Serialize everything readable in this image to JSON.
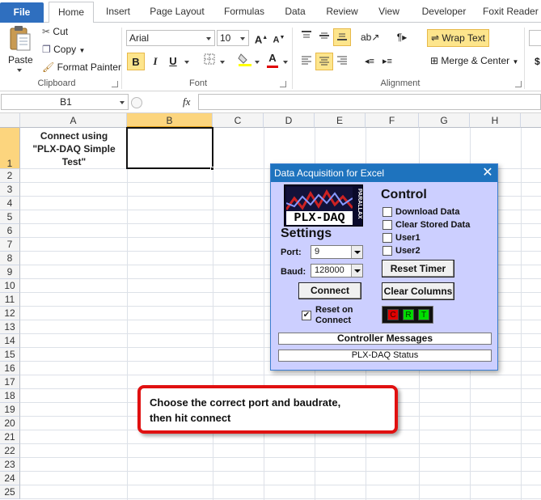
{
  "tabs": [
    "File",
    "Home",
    "Insert",
    "Page Layout",
    "Formulas",
    "Data",
    "Review",
    "View",
    "Developer",
    "Foxit Reader"
  ],
  "ribbon": {
    "clipboard": {
      "paste": "Paste",
      "cut": "Cut",
      "copy": "Copy",
      "format_painter": "Format Painter",
      "label": "Clipboard"
    },
    "font": {
      "name": "Arial",
      "size": "10",
      "bold": "B",
      "italic": "I",
      "underline": "U",
      "label": "Font"
    },
    "alignment": {
      "wrap_text": "Wrap Text",
      "merge_center": "Merge & Center",
      "label": "Alignment"
    },
    "number_symbol": "$"
  },
  "formula_bar": {
    "name_box": "B1",
    "fx": "fx",
    "content": ""
  },
  "grid": {
    "columns": [
      "A",
      "B",
      "C",
      "D",
      "E",
      "F",
      "G",
      "H"
    ],
    "rows": [
      "1",
      "2",
      "3",
      "4",
      "5",
      "6",
      "7",
      "8",
      "9",
      "10",
      "11",
      "12",
      "13",
      "14",
      "15",
      "16",
      "17",
      "18",
      "19",
      "20",
      "21",
      "22",
      "23",
      "24",
      "25"
    ],
    "a1_lines": [
      "Connect using",
      "\"PLX-DAQ Simple",
      "Test\""
    ]
  },
  "dialog": {
    "title": "Data Acquisition for Excel",
    "logo_text": "PLX-DAQ",
    "logo_side": "PARALLAX",
    "settings_heading": "Settings",
    "port_label": "Port:",
    "port_value": "9",
    "baud_label": "Baud:",
    "baud_value": "128000",
    "connect_button": "Connect",
    "reset_on_connect_line1": "Reset on",
    "reset_on_connect_line2": "Connect",
    "control_heading": "Control",
    "download_data": "Download Data",
    "clear_stored_data": "Clear Stored Data",
    "user1": "User1",
    "user2": "User2",
    "reset_timer": "Reset Timer",
    "clear_columns": "Clear Columns",
    "indicators": [
      "C",
      "R",
      "T"
    ],
    "controller_messages": "Controller Messages",
    "status": "PLX-DAQ Status"
  },
  "callout": {
    "line1": "Choose the correct port and baudrate,",
    "line2": "then hit connect"
  },
  "colors": {
    "file_tab": "#2f6fbf",
    "dialog_bg": "#cccfff",
    "dialog_title": "#1e73be",
    "callout_border": "#e01010",
    "indicator_red": "#e00000",
    "indicator_green": "#00dd00"
  }
}
